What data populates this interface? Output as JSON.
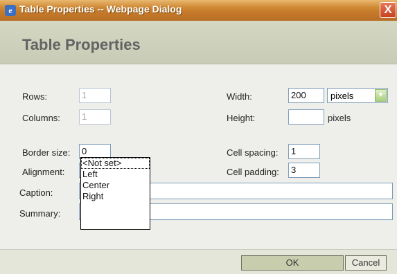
{
  "window": {
    "title": "Table Properties -- Webpage Dialog",
    "close_label": "X",
    "icon_label": "e"
  },
  "header": {
    "title": "Table Properties"
  },
  "form": {
    "rows": {
      "label": "Rows:",
      "value": "1"
    },
    "columns": {
      "label": "Columns:",
      "value": "1"
    },
    "width": {
      "label": "Width:",
      "value": "200",
      "unit_selected": "pixels"
    },
    "height": {
      "label": "Height:",
      "value": "",
      "unit": "pixels"
    },
    "border_size": {
      "label": "Border size:",
      "value": "0"
    },
    "alignment": {
      "label": "Alignment:",
      "value": ""
    },
    "cell_spacing": {
      "label": "Cell spacing:",
      "value": "1"
    },
    "cell_padding": {
      "label": "Cell padding:",
      "value": "3"
    },
    "caption": {
      "label": "Caption:",
      "value": ""
    },
    "summary": {
      "label": "Summary:",
      "value": ""
    }
  },
  "alignment_dropdown": {
    "options": [
      "<Not set>",
      "Left",
      "Center",
      "Right"
    ],
    "highlighted_index": 0
  },
  "buttons": {
    "ok": "OK",
    "cancel": "Cancel"
  },
  "colors": {
    "titlebar": "#c5792a",
    "header_band": "#d4d8c2",
    "dialog_bg": "#eeeeea",
    "ok_button": "#c8cdae"
  }
}
